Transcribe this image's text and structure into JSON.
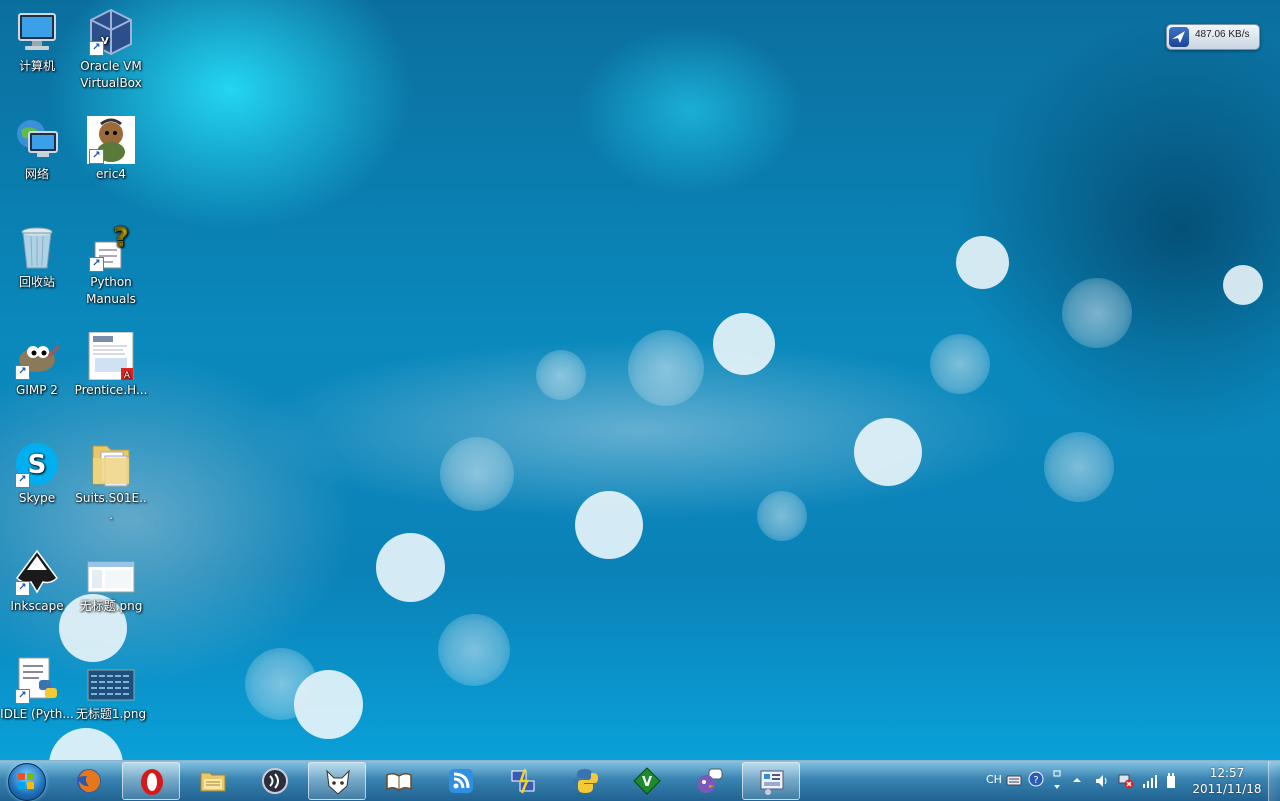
{
  "desktop_icons": [
    {
      "label": "计算机",
      "icon": "computer-icon"
    },
    {
      "label": "Oracle VM VirtualBox",
      "icon": "virtualbox-icon"
    },
    {
      "label": "网络",
      "icon": "network-icon"
    },
    {
      "label": "eric4",
      "icon": "eric4-icon"
    },
    {
      "label": "回收站",
      "icon": "recycle-bin-icon"
    },
    {
      "label": "Python Manuals",
      "icon": "python-manuals-icon"
    },
    {
      "label": "GIMP 2",
      "icon": "gimp-icon"
    },
    {
      "label": "Prentice.H...",
      "icon": "pdf-document-icon"
    },
    {
      "label": "Skype",
      "icon": "skype-icon"
    },
    {
      "label": "Suits.S01E...",
      "icon": "folder-icon"
    },
    {
      "label": "Inkscape",
      "icon": "inkscape-icon"
    },
    {
      "label": "无标题.png",
      "icon": "image-file-icon"
    },
    {
      "label": "IDLE (Pyth...",
      "icon": "idle-python-icon"
    },
    {
      "label": "无标题1.png",
      "icon": "image-file-icon"
    }
  ],
  "network_meter": {
    "speed": "487.06 KB/s"
  },
  "taskbar": {
    "pinned": [
      {
        "icon": "firefox-icon"
      },
      {
        "icon": "opera-icon",
        "active": true
      },
      {
        "icon": "file-explorer-icon"
      },
      {
        "icon": "media-player-icon"
      },
      {
        "icon": "foxmail-icon",
        "active": true
      },
      {
        "icon": "book-reader-icon"
      },
      {
        "icon": "rss-reader-icon"
      },
      {
        "icon": "network-tool-icon"
      },
      {
        "icon": "python-icon"
      },
      {
        "icon": "vim-icon"
      },
      {
        "icon": "pidgin-icon"
      },
      {
        "icon": "control-panel-icon",
        "active": true
      }
    ],
    "tray": {
      "language": "CH"
    },
    "clock": {
      "time": "12:57",
      "date": "2011/11/18"
    }
  }
}
